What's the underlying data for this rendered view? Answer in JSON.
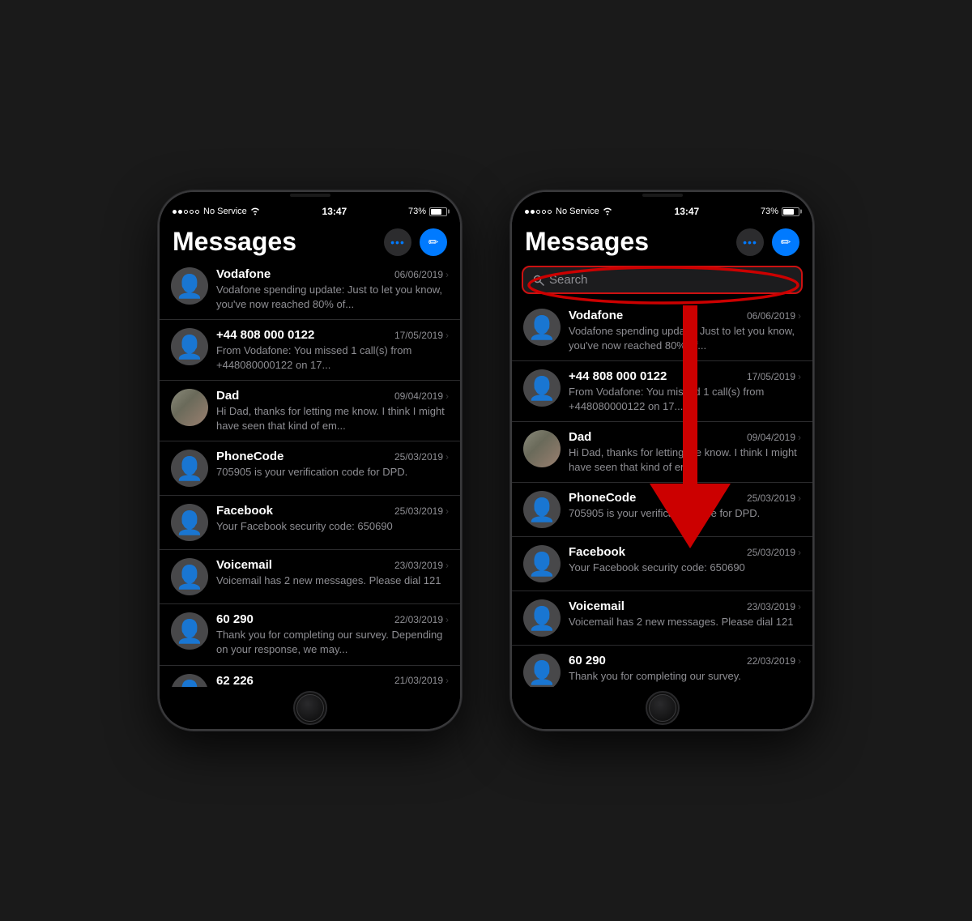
{
  "phones": [
    {
      "id": "phone-left",
      "statusBar": {
        "signal": "No Service",
        "wifi": true,
        "time": "13:47",
        "battery": "73%"
      },
      "app": {
        "title": "Messages",
        "hasSearchBar": false,
        "messages": [
          {
            "sender": "Vodafone",
            "date": "06/06/2019",
            "preview": "Vodafone spending update: Just to let you know, you've now reached 80% of...",
            "hasAvatar": false
          },
          {
            "sender": "+44 808 000 0122",
            "date": "17/05/2019",
            "preview": "From Vodafone: You missed 1 call(s) from +448080000122 on 17...",
            "hasAvatar": false
          },
          {
            "sender": "Dad",
            "date": "09/04/2019",
            "preview": "Hi Dad, thanks for letting me know. I think I might have seen that kind of em...",
            "hasAvatar": true,
            "isDad": true
          },
          {
            "sender": "PhoneCode",
            "date": "25/03/2019",
            "preview": "705905 is your verification code for DPD.",
            "hasAvatar": false
          },
          {
            "sender": "Facebook",
            "date": "25/03/2019",
            "preview": "Your Facebook security code: 650690",
            "hasAvatar": false
          },
          {
            "sender": "Voicemail",
            "date": "23/03/2019",
            "preview": "Voicemail has 2 new messages. Please dial 121",
            "hasAvatar": false
          },
          {
            "sender": "60 290",
            "date": "22/03/2019",
            "preview": "Thank you for completing our survey. Depending on your response, we may...",
            "hasAvatar": false
          },
          {
            "sender": "62 226",
            "date": "21/03/2019",
            "preview": "",
            "hasAvatar": false
          }
        ]
      }
    },
    {
      "id": "phone-right",
      "statusBar": {
        "signal": "No Service",
        "wifi": true,
        "time": "13:47",
        "battery": "73%"
      },
      "app": {
        "title": "Messages",
        "hasSearchBar": true,
        "searchPlaceholder": "Search",
        "messages": [
          {
            "sender": "Vodafone",
            "date": "06/06/2019",
            "preview": "Vodafone spending update: Just to let you know, you've now reached 80% of...",
            "hasAvatar": false
          },
          {
            "sender": "+44 808 000 0122",
            "date": "17/05/2019",
            "preview": "From Vodafone: You missed 1 call(s) from +448080000122 on 17...",
            "hasAvatar": false
          },
          {
            "sender": "Dad",
            "date": "09/04/2019",
            "preview": "Hi Dad, thanks for letting me know. I think I might have seen that kind of em...",
            "hasAvatar": true,
            "isDad": true
          },
          {
            "sender": "PhoneCode",
            "date": "25/03/2019",
            "preview": "705905 is your verification code for DPD.",
            "hasAvatar": false
          },
          {
            "sender": "Facebook",
            "date": "25/03/2019",
            "preview": "Your Facebook security code: 650690",
            "hasAvatar": false
          },
          {
            "sender": "Voicemail",
            "date": "23/03/2019",
            "preview": "Voicemail has 2 new messages. Please dial 121",
            "hasAvatar": false
          },
          {
            "sender": "60 290",
            "date": "22/03/2019",
            "preview": "Thank you for completing our survey.",
            "hasAvatar": false
          }
        ]
      }
    }
  ],
  "labels": {
    "messages": "Messages",
    "search": "Search",
    "dotsBtn": "•••",
    "composeBtn": "✏",
    "noService": "No Service"
  },
  "colors": {
    "accent": "#007AFF",
    "background": "#000000",
    "surface": "#1c1c1e",
    "text": "#ffffff",
    "secondaryText": "#8e8e93",
    "separator": "#2c2c2e",
    "annotationRed": "#cc0000"
  }
}
